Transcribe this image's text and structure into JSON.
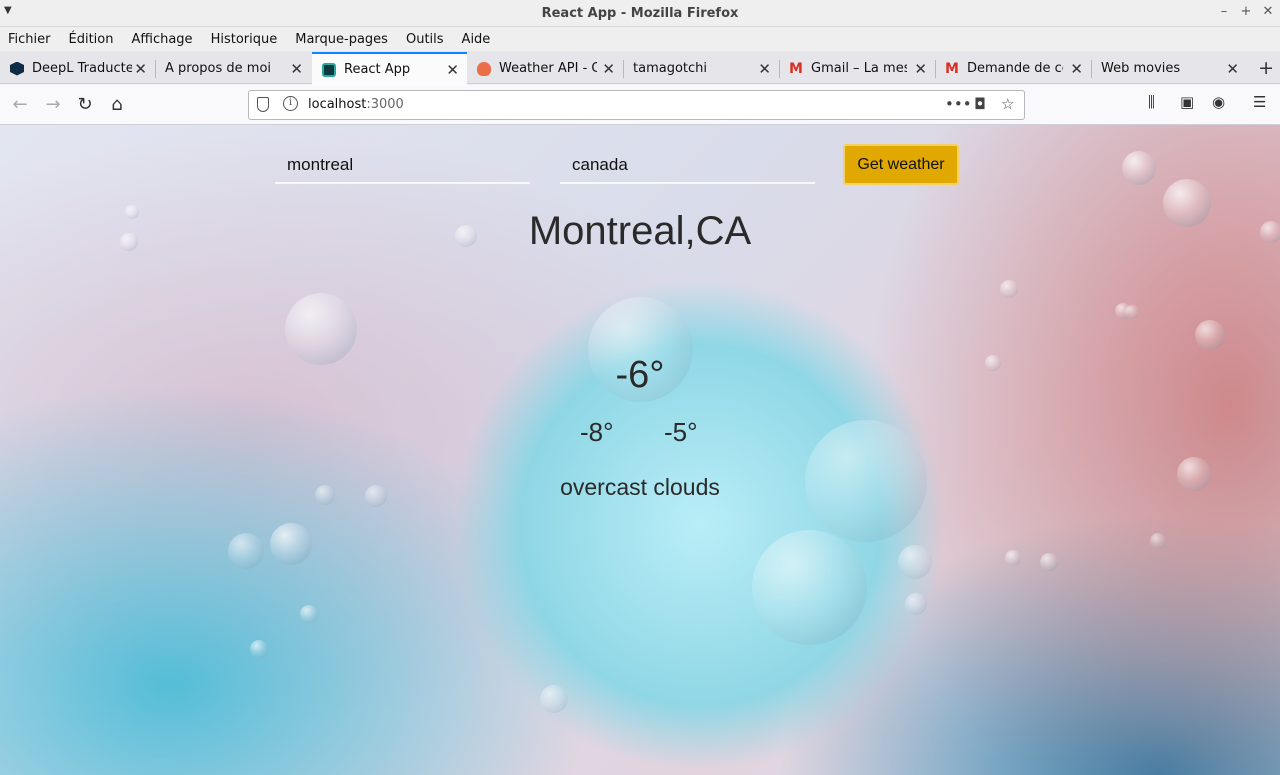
{
  "window": {
    "title": "React App - Mozilla Firefox"
  },
  "menu": [
    "Fichier",
    "Édition",
    "Affichage",
    "Historique",
    "Marque-pages",
    "Outils",
    "Aide"
  ],
  "tabs": [
    {
      "title": "DeepL Traducteur",
      "icon": "deepl-icon"
    },
    {
      "title": "A propos de moi",
      "icon": ""
    },
    {
      "title": "React App",
      "icon": "react-icon",
      "active": true
    },
    {
      "title": "Weather API - OpenWeatherMap",
      "icon": "openweather-icon"
    },
    {
      "title": "tamagotchi",
      "icon": ""
    },
    {
      "title": "Gmail – La messagerie",
      "icon": "gmail-icon"
    },
    {
      "title": "Demande de contact",
      "icon": "gmail-icon"
    },
    {
      "title": "Web movies",
      "icon": ""
    }
  ],
  "url": {
    "host": "localhost",
    "port": ":3000"
  },
  "form": {
    "city_value": "montreal",
    "country_value": "canada",
    "button_label": "Get weather"
  },
  "weather": {
    "city": "Montreal,CA",
    "temp": "-6°",
    "temp_min": "-8°",
    "temp_max": "-5°",
    "description": "overcast clouds"
  },
  "colors": {
    "button_bg": "#e0a800",
    "active_tab_accent": "#0a84ff"
  }
}
